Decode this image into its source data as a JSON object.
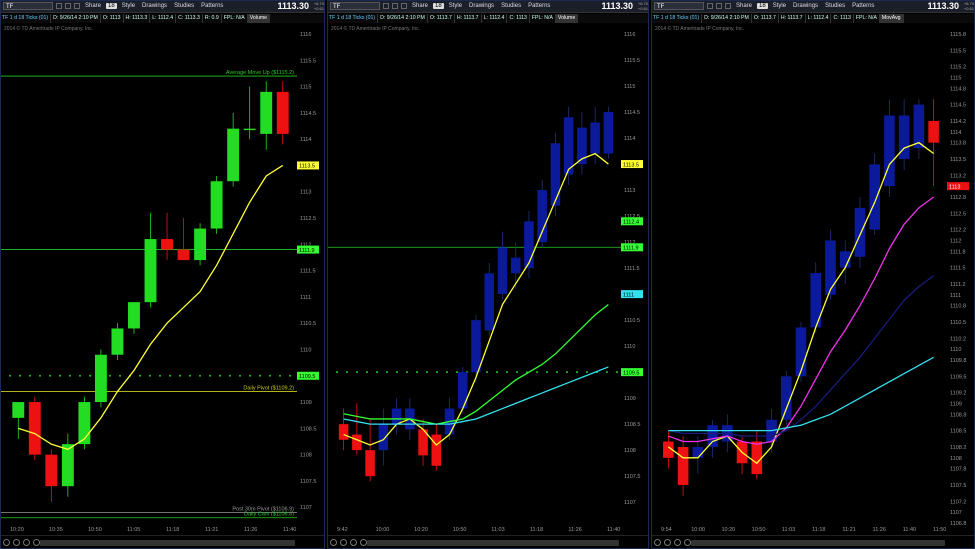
{
  "toolbar": {
    "share": "Share",
    "style": "Style",
    "drawings": "Drawings",
    "studies": "Studies",
    "patterns": "Patterns",
    "dd": "18"
  },
  "copyright": "2014 © TD Ameritrade IP Company, Inc.",
  "colors": {
    "up": "#22dd22",
    "down": "#ee1111",
    "blueUp": "#0a1a9a",
    "yellow": "#ffff33",
    "green": "#33ff33",
    "cyan": "#33e0ee",
    "magenta": "#ee33ee",
    "navy": "#1a1a7a",
    "axis": "#999999",
    "levelGreen": "#22cc22",
    "levelYellow": "#cccc22"
  },
  "panels": [
    {
      "symbol": "TF",
      "price": "1113.30",
      "tiny": [
        "+6.70",
        "+0.61"
      ],
      "info": [
        "TF 1 d 18 Ticks (01)",
        "D: 9/26/14 2:10 PM",
        "O: 1113",
        "H: 1113.3",
        "L: 1112.4",
        "C: 1113.3",
        "R: 0.9",
        "FPL: N/A",
        "Volume"
      ],
      "axis": {
        "min": 1106.7,
        "max": 1116.0,
        "ticks": [
          "1116",
          "1115.5",
          "1115",
          "1114.5",
          "1114",
          "1113.5",
          "1113",
          "1112.5",
          "1112",
          "1111.5",
          "1111",
          "1110.5",
          "1110",
          "1109.5",
          "1109",
          "1108.5",
          "1108",
          "1107.5",
          "1107"
        ]
      },
      "xticks": [
        "10:20",
        "10:35",
        "10:50",
        "11:05",
        "11:18",
        "11:21",
        "11:26",
        "11:40"
      ],
      "levels": [
        {
          "value": 1115.2,
          "color": "levelGreen",
          "label": "Average Move Up ($1115.2)",
          "dots": false
        },
        {
          "value": 1111.9,
          "color": "levelGreen",
          "label": "",
          "dots": false
        },
        {
          "value": 1109.5,
          "color": "levelGreen",
          "label": "",
          "dots": true
        },
        {
          "value": 1109.2,
          "color": "levelYellow",
          "label": "Daily Pivot ($1109.2)",
          "dots": false
        },
        {
          "value": 1106.9,
          "color": "axis",
          "label": "Post 30m Pivot ($1106.9)",
          "dots": false
        },
        {
          "value": 1106.8,
          "color": "levelGreen",
          "label": "Daily Cam ($1106.8)",
          "dots": false
        }
      ],
      "badges": [
        {
          "value": 1113.5,
          "text": "1113.5",
          "bg": "#ffff33"
        },
        {
          "value": 1111.9,
          "text": "1111.9",
          "bg": "#33ff33"
        },
        {
          "value": 1109.5,
          "text": "1109.5",
          "bg": "#33ff33"
        }
      ],
      "candles": [
        {
          "o": 1108.7,
          "h": 1108.9,
          "l": 1108.3,
          "c": 1109.0,
          "kind": "up"
        },
        {
          "o": 1109.0,
          "h": 1109.1,
          "l": 1107.9,
          "c": 1108.0,
          "kind": "down"
        },
        {
          "o": 1108.0,
          "h": 1108.1,
          "l": 1107.1,
          "c": 1107.4,
          "kind": "down"
        },
        {
          "o": 1107.4,
          "h": 1108.4,
          "l": 1107.2,
          "c": 1108.2,
          "kind": "up"
        },
        {
          "o": 1108.2,
          "h": 1109.1,
          "l": 1108.1,
          "c": 1109.0,
          "kind": "up"
        },
        {
          "o": 1109.0,
          "h": 1110.0,
          "l": 1108.9,
          "c": 1109.9,
          "kind": "up"
        },
        {
          "o": 1109.9,
          "h": 1110.5,
          "l": 1109.8,
          "c": 1110.4,
          "kind": "up"
        },
        {
          "o": 1110.4,
          "h": 1110.9,
          "l": 1110.3,
          "c": 1110.9,
          "kind": "up"
        },
        {
          "o": 1110.9,
          "h": 1112.6,
          "l": 1110.8,
          "c": 1112.1,
          "kind": "up"
        },
        {
          "o": 1112.1,
          "h": 1112.6,
          "l": 1111.7,
          "c": 1111.9,
          "kind": "down"
        },
        {
          "o": 1111.9,
          "h": 1112.5,
          "l": 1111.8,
          "c": 1111.7,
          "kind": "down"
        },
        {
          "o": 1111.7,
          "h": 1112.4,
          "l": 1111.6,
          "c": 1112.3,
          "kind": "up"
        },
        {
          "o": 1112.3,
          "h": 1113.3,
          "l": 1112.2,
          "c": 1113.2,
          "kind": "up"
        },
        {
          "o": 1113.2,
          "h": 1114.5,
          "l": 1113.1,
          "c": 1114.2,
          "kind": "up"
        },
        {
          "o": 1114.2,
          "h": 1115.0,
          "l": 1114.0,
          "c": 1114.2,
          "kind": "up"
        },
        {
          "o": 1114.1,
          "h": 1115.1,
          "l": 1113.8,
          "c": 1114.9,
          "kind": "up"
        },
        {
          "o": 1114.9,
          "h": 1115.1,
          "l": 1113.9,
          "c": 1114.1,
          "kind": "down"
        }
      ],
      "ma": [
        {
          "color": "yellow",
          "values": [
            1108.5,
            1108.4,
            1108.2,
            1108.1,
            1108.3,
            1108.7,
            1109.2,
            1109.6,
            1110.1,
            1110.5,
            1110.8,
            1111.1,
            1111.6,
            1112.2,
            1112.8,
            1113.3,
            1113.5
          ]
        }
      ]
    },
    {
      "symbol": "TF",
      "price": "1113.30",
      "tiny": [
        "+6.70",
        "+0.61"
      ],
      "info": [
        "TF 1 d 18 Ticks (01)",
        "D: 9/26/14 2:10 PM",
        "O: 1113.7",
        "H: 1113.7",
        "L: 1112.4",
        "C: 1113",
        "FPL: N/A",
        "Volume"
      ],
      "axis": {
        "min": 1106.6,
        "max": 1116.0,
        "ticks": [
          "1116",
          "1115.5",
          "1115",
          "1114.5",
          "1114",
          "1113.5",
          "1113",
          "1112.5",
          "1112",
          "1111.5",
          "1111",
          "1110.5",
          "1110",
          "1109.5",
          "1109",
          "1108.5",
          "1108",
          "1107.5",
          "1107"
        ]
      },
      "xticks": [
        "9:42",
        "10:00",
        "10:20",
        "10:50",
        "11:03",
        "11:18",
        "11:26",
        "11:40"
      ],
      "levels": [
        {
          "value": 1111.9,
          "color": "levelGreen",
          "label": "",
          "dots": false
        },
        {
          "value": 1109.5,
          "color": "levelGreen",
          "label": "",
          "dots": true
        }
      ],
      "badges": [
        {
          "value": 1113.5,
          "text": "1113.5",
          "bg": "#ffff33"
        },
        {
          "value": 1112.4,
          "text": "1112.4",
          "bg": "#33ff33"
        },
        {
          "value": 1111.9,
          "text": "1111.9",
          "bg": "#33ff33"
        },
        {
          "value": 1111,
          "text": "1111",
          "bg": "#33e0ee"
        },
        {
          "value": 1109.5,
          "text": "1109.5",
          "bg": "#33ff33"
        }
      ],
      "candles": [
        {
          "o": 1108.5,
          "h": 1108.8,
          "l": 1108.0,
          "c": 1108.2,
          "kind": "down"
        },
        {
          "o": 1108.3,
          "h": 1108.9,
          "l": 1107.9,
          "c": 1108.0,
          "kind": "down"
        },
        {
          "o": 1108.0,
          "h": 1108.6,
          "l": 1107.4,
          "c": 1107.5,
          "kind": "down"
        },
        {
          "o": 1108.0,
          "h": 1108.8,
          "l": 1107.7,
          "c": 1108.5,
          "kind": "blue"
        },
        {
          "o": 1108.5,
          "h": 1109.0,
          "l": 1108.3,
          "c": 1108.8,
          "kind": "blue"
        },
        {
          "o": 1108.8,
          "h": 1109.0,
          "l": 1108.2,
          "c": 1108.4,
          "kind": "blue"
        },
        {
          "o": 1108.4,
          "h": 1108.6,
          "l": 1107.7,
          "c": 1107.9,
          "kind": "down"
        },
        {
          "o": 1108.3,
          "h": 1108.5,
          "l": 1107.6,
          "c": 1107.7,
          "kind": "down"
        },
        {
          "o": 1108.3,
          "h": 1109.0,
          "l": 1108.2,
          "c": 1108.8,
          "kind": "blue"
        },
        {
          "o": 1108.8,
          "h": 1109.6,
          "l": 1108.7,
          "c": 1109.5,
          "kind": "blue"
        },
        {
          "o": 1109.5,
          "h": 1110.6,
          "l": 1109.3,
          "c": 1110.5,
          "kind": "blue"
        },
        {
          "o": 1110.3,
          "h": 1111.6,
          "l": 1110.2,
          "c": 1111.4,
          "kind": "blue"
        },
        {
          "o": 1111.0,
          "h": 1112.2,
          "l": 1110.9,
          "c": 1111.9,
          "kind": "blue"
        },
        {
          "o": 1111.4,
          "h": 1112.0,
          "l": 1111.1,
          "c": 1111.7,
          "kind": "blue"
        },
        {
          "o": 1111.5,
          "h": 1112.6,
          "l": 1111.3,
          "c": 1112.4,
          "kind": "blue"
        },
        {
          "o": 1112.0,
          "h": 1113.2,
          "l": 1111.9,
          "c": 1113.0,
          "kind": "blue"
        },
        {
          "o": 1112.7,
          "h": 1114.1,
          "l": 1112.5,
          "c": 1113.9,
          "kind": "blue"
        },
        {
          "o": 1113.3,
          "h": 1114.6,
          "l": 1113.1,
          "c": 1114.4,
          "kind": "blue"
        },
        {
          "o": 1113.5,
          "h": 1114.5,
          "l": 1113.3,
          "c": 1114.2,
          "kind": "blue"
        },
        {
          "o": 1113.7,
          "h": 1114.6,
          "l": 1113.5,
          "c": 1114.3,
          "kind": "blue"
        },
        {
          "o": 1113.7,
          "h": 1114.6,
          "l": 1113.6,
          "c": 1114.5,
          "kind": "blue"
        }
      ],
      "ma": [
        {
          "color": "yellow",
          "values": [
            1108.3,
            1108.2,
            1108.1,
            1108.2,
            1108.5,
            1108.6,
            1108.4,
            1108.1,
            1108.3,
            1108.8,
            1109.4,
            1110.1,
            1110.8,
            1111.2,
            1111.6,
            1112.2,
            1112.8,
            1113.4,
            1113.6,
            1113.7,
            1113.5
          ]
        },
        {
          "color": "green",
          "values": [
            1108.7,
            1108.65,
            1108.6,
            1108.6,
            1108.6,
            1108.6,
            1108.55,
            1108.5,
            1108.55,
            1108.6,
            1108.75,
            1108.95,
            1109.15,
            1109.35,
            1109.5,
            1109.65,
            1109.85,
            1110.1,
            1110.35,
            1110.6,
            1110.8
          ]
        },
        {
          "color": "cyan",
          "values": [
            1108.6,
            1108.55,
            1108.5,
            1108.5,
            1108.5,
            1108.5,
            1108.5,
            1108.5,
            1108.5,
            1108.55,
            1108.6,
            1108.7,
            1108.8,
            1108.9,
            1109.0,
            1109.1,
            1109.2,
            1109.3,
            1109.4,
            1109.5,
            1109.6
          ]
        }
      ]
    },
    {
      "symbol": "TF",
      "price": "1113.30",
      "tiny": [
        "+6.70",
        "+0.61"
      ],
      "info": [
        "TF 1 d 18 Ticks (01)",
        "D: 9/26/14 2:10 PM",
        "O: 1113.7",
        "H: 1113.7",
        "L: 1112.4",
        "C: 1113",
        "FPL: N/A",
        "MovAvg"
      ],
      "axis": {
        "min": 1106.8,
        "max": 1115.8,
        "ticks": [
          "1115.8",
          "1115.5",
          "1115.2",
          "1115",
          "1114.8",
          "1114.5",
          "1114.2",
          "1114",
          "1113.8",
          "1113.5",
          "1113.2",
          "1113",
          "1112.8",
          "1112.5",
          "1112.2",
          "1112",
          "1111.8",
          "1111.5",
          "1111.2",
          "1111",
          "1110.8",
          "1110.5",
          "1110.2",
          "1110",
          "1109.8",
          "1109.5",
          "1109.2",
          "1109",
          "1108.8",
          "1108.5",
          "1108.2",
          "1108",
          "1107.8",
          "1107.5",
          "1107.2",
          "1107",
          "1106.8"
        ]
      },
      "xticks": [
        "9:54",
        "10:00",
        "10:20",
        "10:50",
        "11:03",
        "11:18",
        "11:21",
        "11:26",
        "11:40",
        "11:50"
      ],
      "levels": [],
      "badges": [
        {
          "value": 1113,
          "text": "1113",
          "bg": "#ee1111"
        }
      ],
      "candles": [
        {
          "o": 1108.3,
          "h": 1108.5,
          "l": 1107.8,
          "c": 1108.0,
          "kind": "down"
        },
        {
          "o": 1108.2,
          "h": 1108.4,
          "l": 1107.3,
          "c": 1107.5,
          "kind": "down"
        },
        {
          "o": 1108.0,
          "h": 1108.4,
          "l": 1107.7,
          "c": 1108.2,
          "kind": "blue"
        },
        {
          "o": 1108.2,
          "h": 1108.7,
          "l": 1108.0,
          "c": 1108.6,
          "kind": "blue"
        },
        {
          "o": 1108.6,
          "h": 1108.8,
          "l": 1108.1,
          "c": 1108.3,
          "kind": "blue"
        },
        {
          "o": 1108.3,
          "h": 1108.4,
          "l": 1107.7,
          "c": 1107.9,
          "kind": "down"
        },
        {
          "o": 1108.3,
          "h": 1108.5,
          "l": 1107.6,
          "c": 1107.7,
          "kind": "down"
        },
        {
          "o": 1108.3,
          "h": 1108.9,
          "l": 1108.1,
          "c": 1108.7,
          "kind": "blue"
        },
        {
          "o": 1108.7,
          "h": 1109.6,
          "l": 1108.6,
          "c": 1109.5,
          "kind": "blue"
        },
        {
          "o": 1109.5,
          "h": 1110.5,
          "l": 1109.4,
          "c": 1110.4,
          "kind": "blue"
        },
        {
          "o": 1110.4,
          "h": 1111.6,
          "l": 1110.3,
          "c": 1111.4,
          "kind": "blue"
        },
        {
          "o": 1111.0,
          "h": 1112.2,
          "l": 1110.9,
          "c": 1112.0,
          "kind": "blue"
        },
        {
          "o": 1111.5,
          "h": 1112.0,
          "l": 1111.2,
          "c": 1111.8,
          "kind": "blue"
        },
        {
          "o": 1111.7,
          "h": 1112.8,
          "l": 1111.5,
          "c": 1112.6,
          "kind": "blue"
        },
        {
          "o": 1112.2,
          "h": 1113.6,
          "l": 1112.1,
          "c": 1113.4,
          "kind": "blue"
        },
        {
          "o": 1113.0,
          "h": 1114.6,
          "l": 1112.8,
          "c": 1114.3,
          "kind": "blue"
        },
        {
          "o": 1113.5,
          "h": 1114.6,
          "l": 1113.3,
          "c": 1114.3,
          "kind": "blue"
        },
        {
          "o": 1113.7,
          "h": 1114.6,
          "l": 1113.5,
          "c": 1114.5,
          "kind": "blue"
        },
        {
          "o": 1114.2,
          "h": 1114.6,
          "l": 1113.0,
          "c": 1113.8,
          "kind": "down"
        }
      ],
      "ma": [
        {
          "color": "yellow",
          "values": [
            1108.2,
            1108.0,
            1108.0,
            1108.3,
            1108.4,
            1108.1,
            1107.9,
            1108.2,
            1108.9,
            1109.6,
            1110.4,
            1111.1,
            1111.5,
            1112.1,
            1112.7,
            1113.4,
            1113.7,
            1113.8,
            1113.6
          ]
        },
        {
          "color": "magenta",
          "values": [
            1108.4,
            1108.3,
            1108.3,
            1108.35,
            1108.4,
            1108.3,
            1108.25,
            1108.3,
            1108.55,
            1108.95,
            1109.45,
            1109.95,
            1110.35,
            1110.8,
            1111.3,
            1111.85,
            1112.3,
            1112.6,
            1112.8
          ]
        },
        {
          "color": "navy",
          "values": [
            1108.5,
            1108.45,
            1108.45,
            1108.45,
            1108.45,
            1108.4,
            1108.4,
            1108.4,
            1108.5,
            1108.7,
            1108.95,
            1109.25,
            1109.55,
            1109.85,
            1110.2,
            1110.55,
            1110.9,
            1111.15,
            1111.35
          ]
        },
        {
          "color": "cyan",
          "values": [
            1108.5,
            1108.5,
            1108.5,
            1108.5,
            1108.5,
            1108.5,
            1108.5,
            1108.5,
            1108.55,
            1108.6,
            1108.7,
            1108.8,
            1108.95,
            1109.1,
            1109.25,
            1109.4,
            1109.55,
            1109.7,
            1109.85
          ]
        }
      ]
    }
  ]
}
